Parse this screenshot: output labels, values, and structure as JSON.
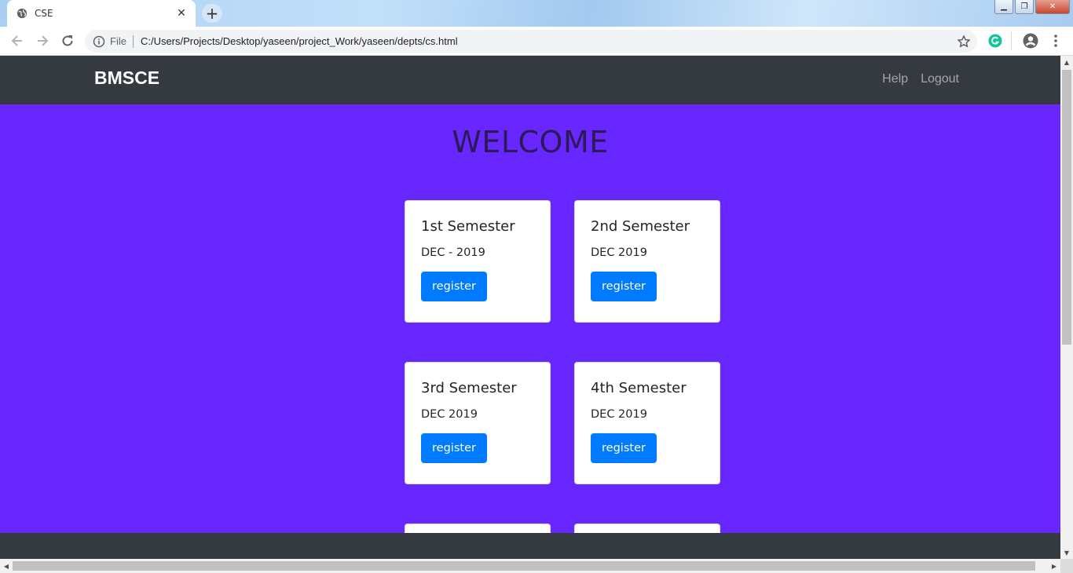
{
  "browser": {
    "tab_title": "CSE",
    "tab_close": "✕",
    "new_tab": "+",
    "omnibox_protocol": "File",
    "url": "C:/Users/Projects/Desktop/yaseen/project_Work/yaseen/depts/cs.html",
    "window_controls": {
      "minimize": "▁",
      "restore": "❐",
      "close": "✕"
    },
    "icons": [
      "globe-icon",
      "back-icon",
      "forward-icon",
      "reload-icon",
      "info-icon",
      "star-icon",
      "grammarly-icon",
      "profile-icon",
      "menu-icon"
    ]
  },
  "page": {
    "brand": "BMSCE",
    "nav": {
      "help": "Help",
      "logout": "Logout"
    },
    "heading": "WELCOME",
    "cards": [
      {
        "title": "1st Semester",
        "date": "DEC - 2019",
        "button": "register"
      },
      {
        "title": "2nd Semester",
        "date": "DEC 2019",
        "button": "register"
      },
      {
        "title": "3rd Semester",
        "date": "DEC 2019",
        "button": "register"
      },
      {
        "title": "4th Semester",
        "date": "DEC 2019",
        "button": "register"
      }
    ]
  },
  "colors": {
    "navbar": "#343a40",
    "background": "#6927ff",
    "button": "#007bff",
    "heading": "#2a1a55"
  }
}
